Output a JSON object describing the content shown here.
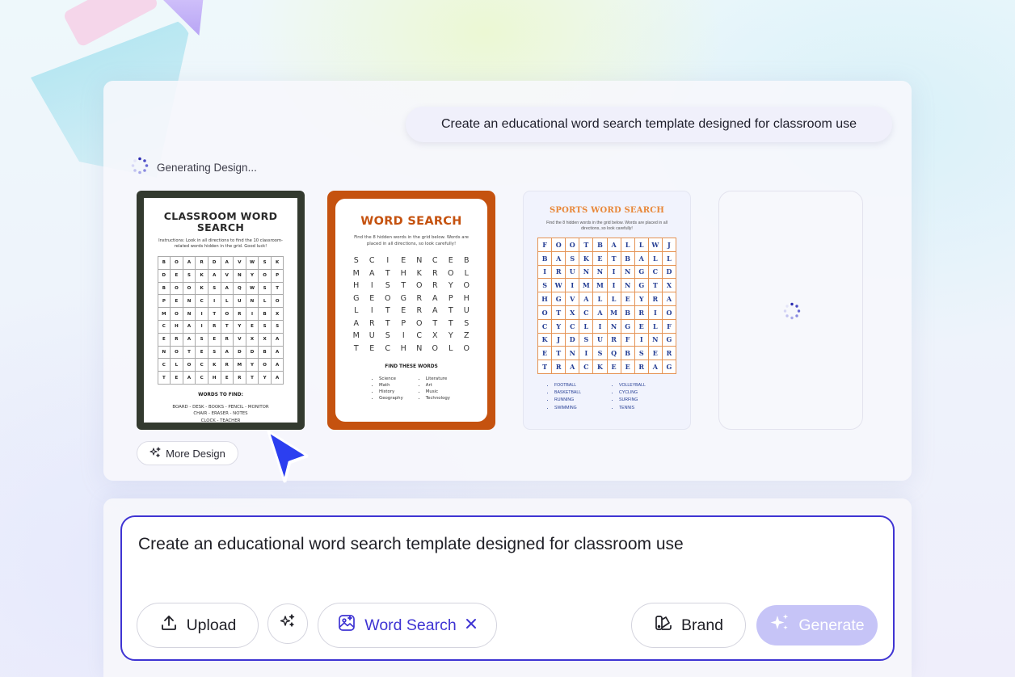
{
  "prompt_bubble": "Create an educational word search template designed for classroom use",
  "status": {
    "text": "Generating Design..."
  },
  "card1": {
    "title_line1": "CLASSROOM WORD",
    "title_line2": "SEARCH",
    "instructions": "Instructions: Look in all directions to find the 10 classroom-related words hidden in the grid. Good luck!",
    "grid": [
      [
        "B",
        "O",
        "A",
        "R",
        "D",
        "A",
        "V",
        "W",
        "S",
        "K"
      ],
      [
        "D",
        "E",
        "S",
        "K",
        "A",
        "V",
        "N",
        "Y",
        "O",
        "P"
      ],
      [
        "B",
        "O",
        "O",
        "K",
        "S",
        "A",
        "Q",
        "W",
        "S",
        "T"
      ],
      [
        "P",
        "E",
        "N",
        "C",
        "I",
        "L",
        "U",
        "N",
        "L",
        "O"
      ],
      [
        "M",
        "O",
        "N",
        "I",
        "T",
        "O",
        "R",
        "I",
        "B",
        "X"
      ],
      [
        "C",
        "H",
        "A",
        "I",
        "R",
        "T",
        "Y",
        "E",
        "S",
        "S"
      ],
      [
        "E",
        "R",
        "A",
        "S",
        "E",
        "R",
        "V",
        "X",
        "X",
        "A"
      ],
      [
        "N",
        "O",
        "T",
        "E",
        "S",
        "A",
        "D",
        "D",
        "B",
        "A"
      ],
      [
        "C",
        "L",
        "O",
        "C",
        "K",
        "R",
        "M",
        "Y",
        "O",
        "A"
      ],
      [
        "T",
        "E",
        "A",
        "C",
        "H",
        "E",
        "R",
        "T",
        "Y",
        "A"
      ]
    ],
    "words_title": "WORDS TO FIND:",
    "words_line1": "BOARD - DESK - BOOKS - PENCIL - MONITOR",
    "words_line2": "CHAIR - ERASER - NOTES",
    "words_line3": "CLOCK - TEACHER"
  },
  "card2": {
    "title": "WORD SEARCH",
    "instructions": "Find the 8 hidden words in the grid below. Words are placed in all directions, so look carefully!",
    "grid": [
      [
        "S",
        "C",
        "I",
        "E",
        "N",
        "C",
        "E",
        "B"
      ],
      [
        "M",
        "A",
        "T",
        "H",
        "K",
        "R",
        "O",
        "L"
      ],
      [
        "H",
        "I",
        "S",
        "T",
        "O",
        "R",
        "Y",
        "O"
      ],
      [
        "G",
        "E",
        "O",
        "G",
        "R",
        "A",
        "P",
        "H"
      ],
      [
        "L",
        "I",
        "T",
        "E",
        "R",
        "A",
        "T",
        "U"
      ],
      [
        "A",
        "R",
        "T",
        "P",
        "O",
        "T",
        "T",
        "S"
      ],
      [
        "M",
        "U",
        "S",
        "I",
        "C",
        "X",
        "Y",
        "Z"
      ],
      [
        "T",
        "E",
        "C",
        "H",
        "N",
        "O",
        "L",
        "O"
      ]
    ],
    "find_title": "FIND THESE WORDS",
    "list_left": [
      "Science",
      "Math",
      "History",
      "Geography"
    ],
    "list_right": [
      "Literature",
      "Art",
      "Music",
      "Technology"
    ]
  },
  "card3": {
    "title": "SPORTS WORD SEARCH",
    "instructions": "Find the 8 hidden words in the grid below. Words are placed in all directions, so look carefully!",
    "grid": [
      [
        "F",
        "O",
        "O",
        "T",
        "B",
        "A",
        "L",
        "L",
        "W",
        "J"
      ],
      [
        "B",
        "A",
        "S",
        "K",
        "E",
        "T",
        "B",
        "A",
        "L",
        "L"
      ],
      [
        "I",
        "R",
        "U",
        "N",
        "N",
        "I",
        "N",
        "G",
        "C",
        "D"
      ],
      [
        "S",
        "W",
        "I",
        "M",
        "M",
        "I",
        "N",
        "G",
        "T",
        "X"
      ],
      [
        "H",
        "G",
        "V",
        "A",
        "L",
        "L",
        "E",
        "Y",
        "R",
        "A"
      ],
      [
        "O",
        "T",
        "X",
        "C",
        "A",
        "M",
        "B",
        "R",
        "I",
        "O"
      ],
      [
        "C",
        "Y",
        "C",
        "L",
        "I",
        "N",
        "G",
        "E",
        "L",
        "F"
      ],
      [
        "K",
        "J",
        "D",
        "S",
        "U",
        "R",
        "F",
        "I",
        "N",
        "G"
      ],
      [
        "E",
        "T",
        "N",
        "I",
        "S",
        "Q",
        "B",
        "S",
        "E",
        "R"
      ],
      [
        "T",
        "R",
        "A",
        "C",
        "K",
        "E",
        "E",
        "R",
        "A",
        "G"
      ]
    ],
    "list_left": [
      "FOOTBALL",
      "BASKETBALL",
      "RUNNING",
      "SWIMMING"
    ],
    "list_right": [
      "VOLLEYBALL",
      "CYCLING",
      "SURFING",
      "TENNIS"
    ]
  },
  "more_design_label": "More Design",
  "input": {
    "value": "Create an educational word search template designed for classroom use"
  },
  "buttons": {
    "upload": "Upload",
    "template_chip": "Word Search",
    "brand": "Brand",
    "generate": "Generate"
  },
  "colors": {
    "accent": "#3f34d3",
    "generate_disabled": "#c6c4f7",
    "card1_frame": "#333a2f",
    "card2_frame": "#c5520f",
    "card3_title": "#e8883a",
    "card3_letters": "#233c93"
  }
}
